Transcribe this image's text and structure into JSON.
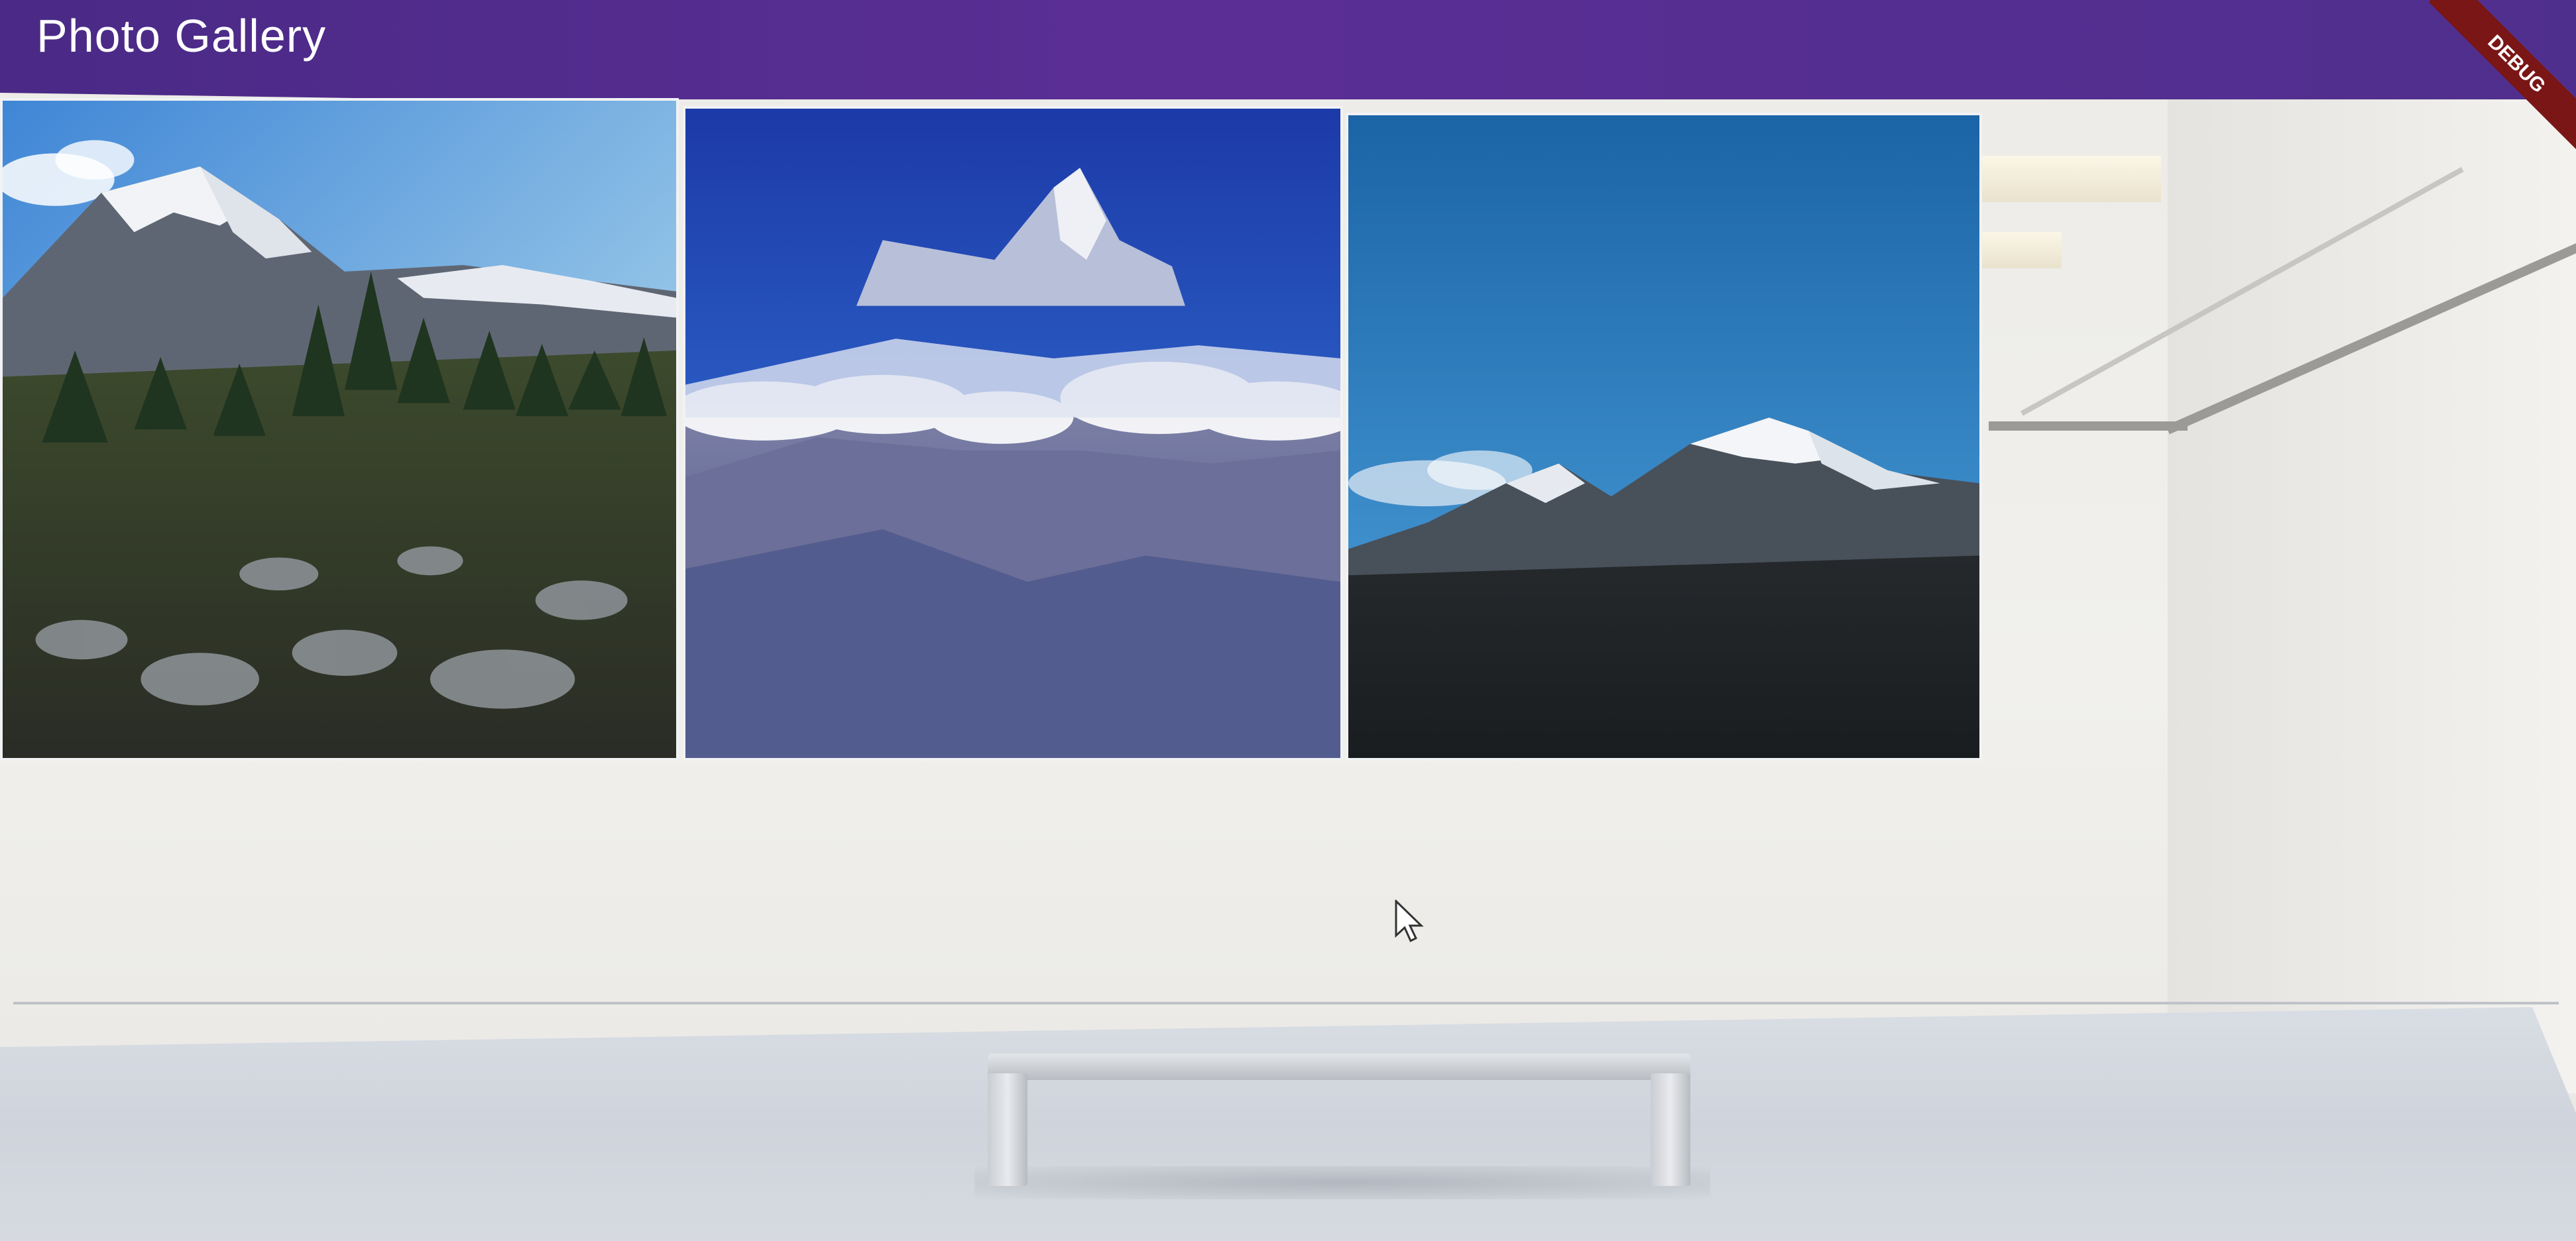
{
  "app_bar": {
    "title": "Photo Gallery",
    "color": "#5b2e95"
  },
  "debug_banner": {
    "label": "DEBUG"
  },
  "gallery": {
    "photos": [
      {
        "subject": "snowy mountain peak with pine forest and rocky foreground"
      },
      {
        "subject": "sharp mountain summit above clouds under deep blue sky"
      },
      {
        "subject": "snow-capped mountain ridge under clear blue sky"
      }
    ]
  }
}
